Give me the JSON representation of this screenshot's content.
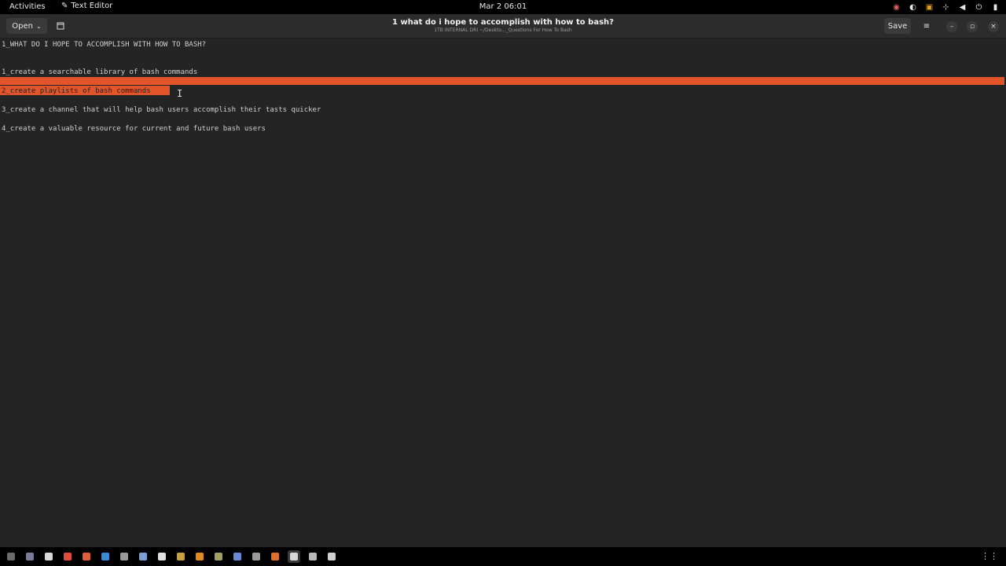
{
  "topbar": {
    "activities": "Activities",
    "app_name": "Text Editor",
    "clock": "Mar 2  06:01",
    "tray_icons": [
      "network-icon",
      "steam-icon",
      "battery-icon",
      "network-tree-icon",
      "volume-icon",
      "power-icon",
      "system-icon"
    ]
  },
  "header": {
    "open_label": "Open",
    "title": "1 what do i hope to accomplish with how to bash?",
    "subtitle": "1TB INTERNAL DRI ~/Deskto..._Questions For How To Bash",
    "save_label": "Save",
    "menu_icon": "≡",
    "min_icon": "–",
    "max_icon": "▫",
    "close_icon": "×"
  },
  "editor": {
    "lines": [
      "1_WHAT DO I HOPE TO ACCOMPLISH WITH HOW TO BASH?",
      "1_create a searchable library of bash commands",
      "2_create playlists of bash commands",
      "3_create a channel that will help bash users accomplish their tasts quicker",
      "4_create a valuable resource for current and future bash users"
    ],
    "highlight_color": "#e2552a"
  },
  "dock": {
    "icons": [
      {
        "name": "files-icon",
        "color": "#6b6b6b"
      },
      {
        "name": "monitor-icon",
        "color": "#7a7a9a"
      },
      {
        "name": "document-icon",
        "color": "#d8d8d8"
      },
      {
        "name": "chrome-icon",
        "color": "#e04b3a"
      },
      {
        "name": "brave-icon",
        "color": "#e0603a"
      },
      {
        "name": "steam-icon",
        "color": "#3a8ad8"
      },
      {
        "name": "settings-icon",
        "color": "#9a9a9a"
      },
      {
        "name": "code-icon",
        "color": "#7aa0d8"
      },
      {
        "name": "circle-app-icon",
        "color": "#e0e0e0"
      },
      {
        "name": "archive-icon",
        "color": "#c8a040"
      },
      {
        "name": "vlc-icon",
        "color": "#e08a20"
      },
      {
        "name": "game-icon",
        "color": "#a0a060"
      },
      {
        "name": "browser-icon",
        "color": "#6a8ad8"
      },
      {
        "name": "tool-icon",
        "color": "#9a9a9a"
      },
      {
        "name": "firefox-icon",
        "color": "#e0702a"
      },
      {
        "name": "text-editor-icon",
        "color": "#d8d8d8"
      },
      {
        "name": "notes-icon",
        "color": "#b8b8b8"
      },
      {
        "name": "calculator-icon",
        "color": "#d0d0d0"
      }
    ],
    "active_index": 15,
    "grid_icon": "⋮⋮"
  }
}
